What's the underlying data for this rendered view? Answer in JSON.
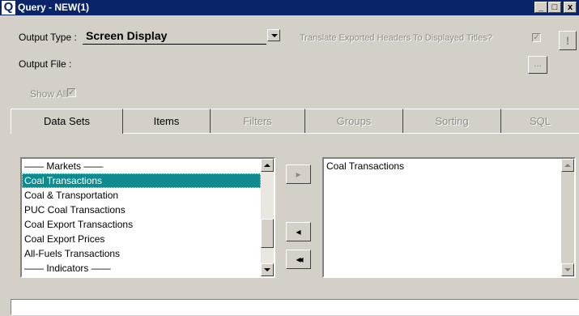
{
  "window": {
    "title": "Query - NEW(1)",
    "app_icon": "Q",
    "min_label": "_",
    "max_label": "□",
    "close_label": "x"
  },
  "output_type": {
    "label": "Output Type :",
    "value": "Screen Display"
  },
  "translate": {
    "label": "Translate Exported Headers To Displayed Titles?",
    "checked": true
  },
  "exclaim_label": "!",
  "output_file": {
    "label": "Output File :",
    "browse_label": "..."
  },
  "show_all": {
    "label": "Show All",
    "checked": true
  },
  "tabs": [
    {
      "label": "Data Sets",
      "enabled": true
    },
    {
      "label": "Items",
      "enabled": true
    },
    {
      "label": "Filters",
      "enabled": false
    },
    {
      "label": "Groups",
      "enabled": false
    },
    {
      "label": "Sorting",
      "enabled": false
    },
    {
      "label": "SQL",
      "enabled": false
    }
  ],
  "available_list": {
    "items": [
      {
        "label": "—— Markets ——"
      },
      {
        "label": "Coal Transactions",
        "selected": true
      },
      {
        "label": "Coal & Transportation"
      },
      {
        "label": "PUC Coal Transactions"
      },
      {
        "label": "Coal Export Transactions"
      },
      {
        "label": "Coal Export Prices"
      },
      {
        "label": "All-Fuels Transactions"
      },
      {
        "label": "—— Indicators ——"
      }
    ]
  },
  "selected_list": {
    "items": [
      {
        "label": "Coal Transactions"
      }
    ]
  },
  "move_buttons": {
    "add": "▸",
    "remove": "◂",
    "remove_all": "◂◂"
  }
}
